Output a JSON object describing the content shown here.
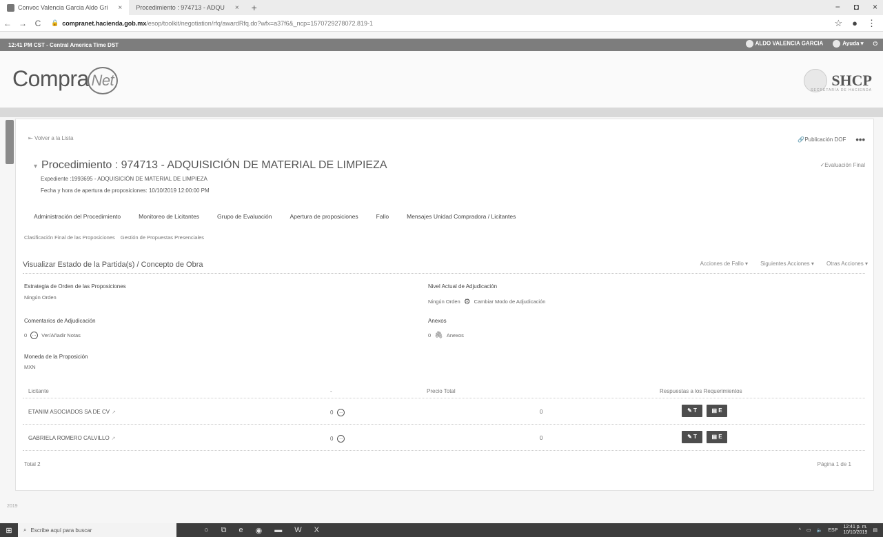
{
  "browser": {
    "tabs": [
      {
        "title": "Convoc Valencia Garcia Aldo Gri",
        "close": "×"
      },
      {
        "title": "Procedimiento : 974713 - ADQU",
        "close": "×"
      }
    ],
    "new_tab": "+",
    "url_host": "compranet.hacienda.gob.mx",
    "url_path": "/esop/toolkit/negotiation/rfq/awardRfq.do?wfx=a37f6&_ncp=1570729278072.819-1",
    "window_controls": [
      "−",
      "◘",
      "×"
    ]
  },
  "topbar": {
    "time": "12:41 PM CST - Central America Time DST",
    "user": "ALDO VALENCIA GARCIA",
    "help": "Ayuda"
  },
  "brand": {
    "logo_text": "Compra",
    "logo_net": "Net",
    "agency": "SHCP",
    "agency_sub": "SECRETARÍA DE HACIENDA"
  },
  "procedure": {
    "back": "Volver a la Lista",
    "publicacion": "Publicación DOF",
    "title": "Procedimiento : 974713 - ADQUISICIÓN DE MATERIAL DE LIMPIEZA",
    "status": "Evaluación Final",
    "expediente": "Expediente :1993695 - ADQUISICIÓN DE MATERIAL DE LIMPIEZA",
    "fecha": "Fecha y hora de apertura de proposiciones: 10/10/2019 12:00:00 PM"
  },
  "tabs": [
    "Administración del Procedimiento",
    "Monitoreo de Licitantes",
    "Grupo de Evaluación",
    "Apertura de proposiciones",
    "Fallo",
    "Mensajes Unidad Compradora / Licitantes"
  ],
  "subtabs": [
    "Clasificación Final de las Proposiciones",
    "Gestión de Propuestas Presenciales"
  ],
  "section": {
    "title": "Visualizar Estado de la Partida(s) / Concepto de Obra",
    "actions": [
      "Acciones de Fallo",
      "Siguientes Acciones",
      "Otras Acciones"
    ]
  },
  "fields": {
    "estrategia_label": "Estrategia de Orden de las Proposiciones",
    "estrategia_value": "Ningún Orden",
    "nivel_label": "Nivel Actual de Adjudicación",
    "nivel_value": "Ningún Orden",
    "nivel_action": "Cambiar Modo de Adjudicación",
    "comentarios_label": "Comentarios de Adjudicación",
    "comentarios_count": "0",
    "comentarios_action": "Ver/Añadir Notas",
    "anexos_label": "Anexos",
    "anexos_count": "0",
    "anexos_action": "Anexos",
    "moneda_label": "Moneda de la Proposición",
    "moneda_value": "MXN"
  },
  "table": {
    "headers": [
      "Licitante",
      "-",
      "Precio Total",
      "Respuestas a los Requerimientos"
    ],
    "rows": [
      {
        "name": "ETANIM ASOCIADOS SA DE CV",
        "count": "0",
        "price": "0",
        "btn_t": "T",
        "btn_e": "E"
      },
      {
        "name": "GABRIELA ROMERO CALVILLO",
        "count": "0",
        "price": "0",
        "btn_t": "T",
        "btn_e": "E"
      }
    ],
    "total": "Total 2",
    "pagination": "Página 1 de 1"
  },
  "footer": {
    "year": "2019"
  },
  "taskbar": {
    "search_placeholder": "Escribe aquí para buscar",
    "lang": "ESP",
    "time": "12:41 p. m.",
    "date": "10/10/2019"
  }
}
